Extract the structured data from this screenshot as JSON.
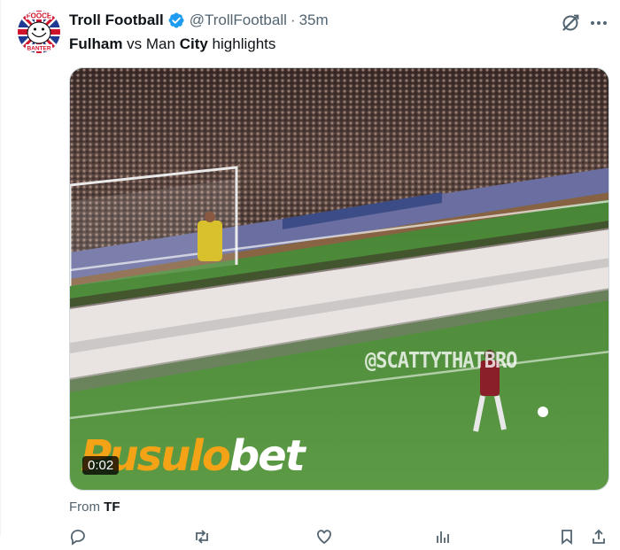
{
  "tweet": {
    "author_name": "Troll Football",
    "handle": "@TrollFootball",
    "separator": "·",
    "time": "35m",
    "verified_icon": "verified-badge-icon",
    "text_part1": "Fulham",
    "text_part2": " vs Man ",
    "text_part3": "City",
    "text_part4": " highlights",
    "avatar_text_top": "FOOCE",
    "avatar_text_bottom": "BANTER"
  },
  "media": {
    "watermark": "@SCATTYTHATBRO",
    "brand_part1": "Pusulo",
    "brand_part2": "bet",
    "duration": "0:02"
  },
  "source": {
    "prefix": "From ",
    "name": "TF"
  },
  "colors": {
    "verified": "#1d9bf0",
    "muted": "#536471",
    "brand_orange": "#f5a316",
    "pitch": "#4f8a37"
  }
}
